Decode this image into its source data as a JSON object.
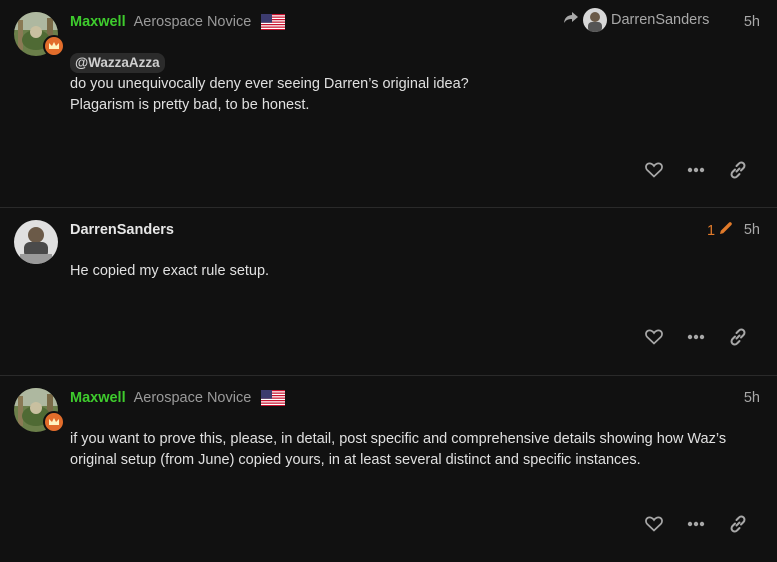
{
  "posts": [
    {
      "username": "Maxwell",
      "user_title": "Aerospace Novice",
      "reply_to_user": "DarrenSanders",
      "time": "5h",
      "mention": "@WazzaAzza",
      "body_lines": [
        "do you unequivocally deny ever seeing Darren’s original idea?",
        "Plagarism is pretty bad, to be honest."
      ]
    },
    {
      "username": "DarrenSanders",
      "edit_count": "1",
      "time": "5h",
      "body_lines": [
        "He copied my exact rule setup."
      ]
    },
    {
      "username": "Maxwell",
      "user_title": "Aerospace Novice",
      "time": "5h",
      "body_lines": [
        "if you want to prove this, please, in detail, post specific and comprehensive details showing how Waz’s",
        "original setup (from June) copied yours, in at least several distinct and specific instances."
      ]
    }
  ],
  "icons": {
    "flag": "us-flag-icon",
    "flair": "crown-icon",
    "like": "heart-icon",
    "more": "ellipsis-icon",
    "share": "link-icon",
    "reply": "reply-arrow-icon",
    "edit": "pencil-icon"
  },
  "colors": {
    "background": "#111111",
    "username_green": "#3ecb2d",
    "edit_orange": "#e07a2a",
    "flair_orange": "#e26d2b"
  }
}
